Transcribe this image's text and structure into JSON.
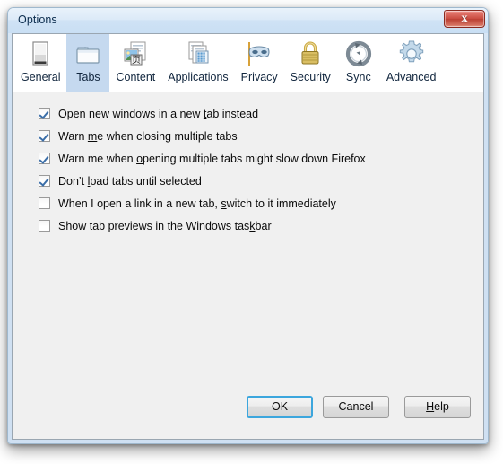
{
  "window": {
    "title": "Options",
    "close_label": "✕",
    "close_icon": "close-icon"
  },
  "tabs": {
    "selected": "Tabs",
    "items": [
      {
        "label": "General",
        "icon": "general-icon"
      },
      {
        "label": "Tabs",
        "icon": "tabs-folder-icon"
      },
      {
        "label": "Content",
        "icon": "content-page-icon"
      },
      {
        "label": "Applications",
        "icon": "applications-icon"
      },
      {
        "label": "Privacy",
        "icon": "privacy-mask-icon"
      },
      {
        "label": "Security",
        "icon": "security-lock-icon"
      },
      {
        "label": "Sync",
        "icon": "sync-arrows-icon"
      },
      {
        "label": "Advanced",
        "icon": "advanced-gear-icon"
      }
    ]
  },
  "options": [
    {
      "checked": true,
      "pre": "Open new windows in a new ",
      "key": "t",
      "post": "ab instead"
    },
    {
      "checked": true,
      "pre": "Warn ",
      "key": "m",
      "post": "e when closing multiple tabs"
    },
    {
      "checked": true,
      "pre": "Warn me when ",
      "key": "o",
      "post": "pening multiple tabs might slow down Firefox"
    },
    {
      "checked": true,
      "pre": "Don’t ",
      "key": "l",
      "post": "oad tabs until selected"
    },
    {
      "checked": false,
      "pre": "When I open a link in a new tab, ",
      "key": "s",
      "post": "witch to it immediately"
    },
    {
      "checked": false,
      "pre": "Show tab previews in the Windows tas",
      "key": "k",
      "post": "bar"
    }
  ],
  "buttons": {
    "ok": {
      "label": "OK",
      "default": true
    },
    "cancel": {
      "label": "Cancel",
      "default": false
    },
    "help": {
      "pre": "",
      "key": "H",
      "post": "elp",
      "default": false
    }
  },
  "colors": {
    "frame": "#cfe0f2",
    "client": "#f0f0f0",
    "tabstrip": "#ffffff",
    "selected_tab": "#c5d9ef",
    "close_button": "#c94b3f",
    "default_button_border": "#3ca6dd",
    "check_mark": "#3b6ea8",
    "title_text": "#0b2c4d"
  }
}
